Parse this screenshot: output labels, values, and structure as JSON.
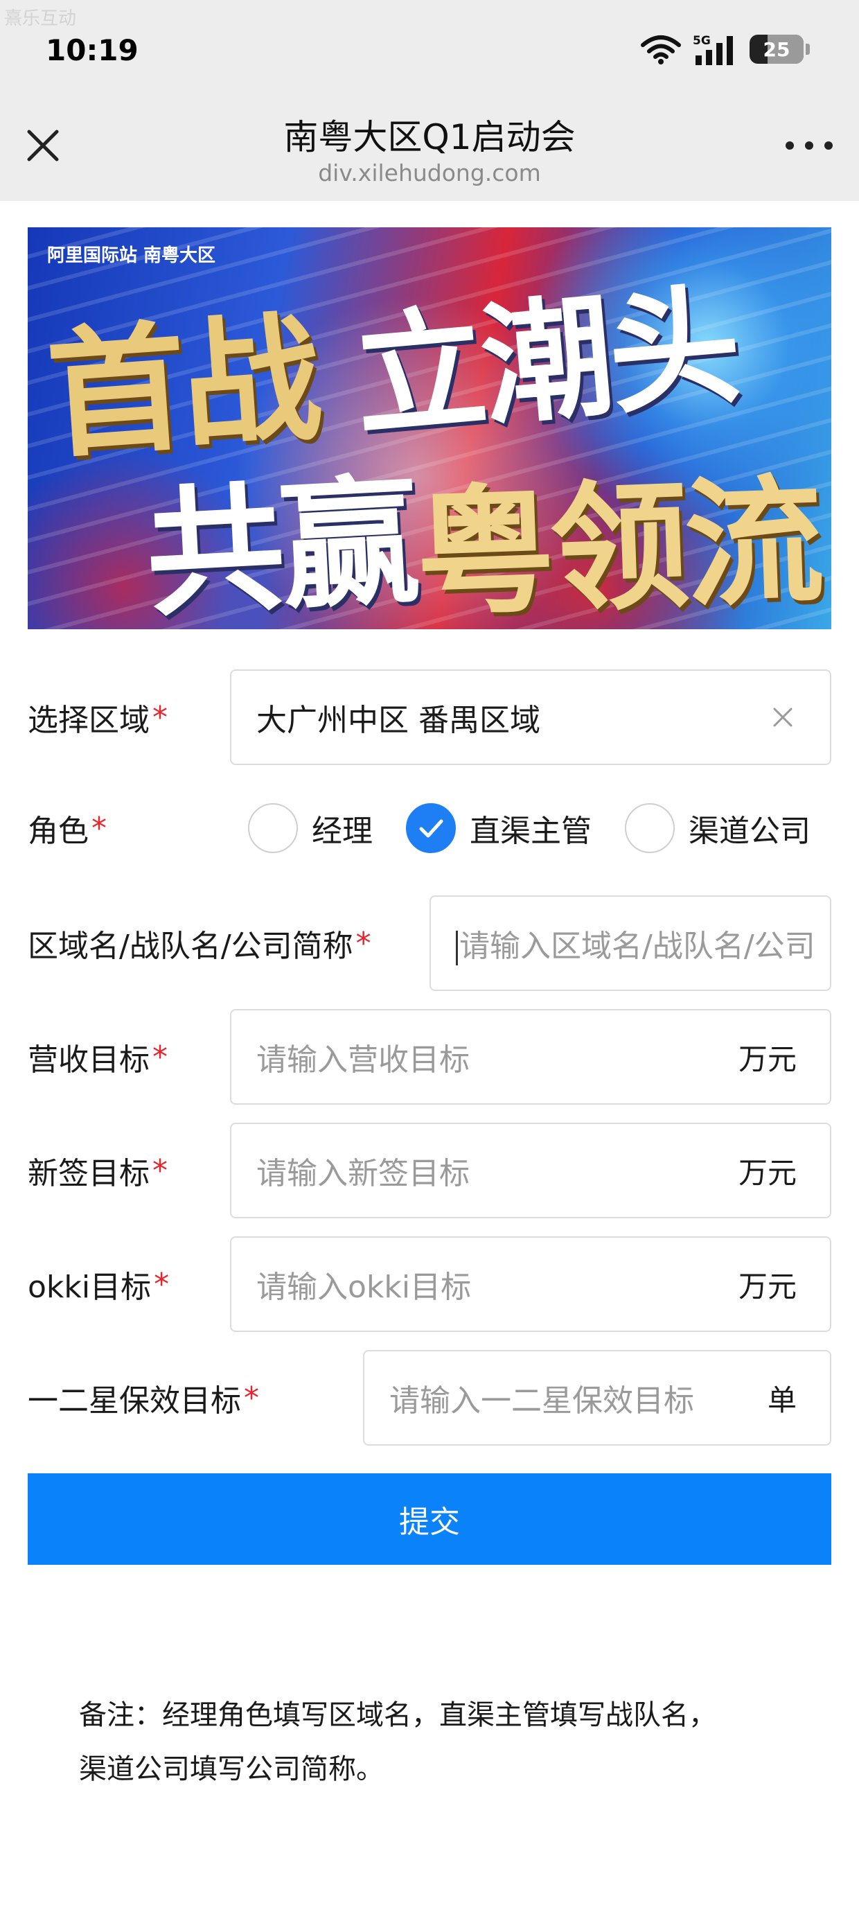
{
  "watermark": "熹乐互动",
  "status_bar": {
    "time": "10:19",
    "network": "5G",
    "battery": "25"
  },
  "titlebar": {
    "title": "南粤大区Q1启动会",
    "domain": "div.xilehudong.com"
  },
  "banner": {
    "logo_text": "阿里国际站 南粤大区",
    "slogan_line1a": "首战",
    "slogan_line1b": "立潮头",
    "slogan_line2a": "共赢",
    "slogan_line2b": "粤领流"
  },
  "form": {
    "region": {
      "label": "选择区域",
      "required": "*",
      "value": "大广州中区 番禺区域"
    },
    "role": {
      "label": "角色",
      "required": "*",
      "options": [
        "经理",
        "直渠主管",
        "渠道公司"
      ],
      "selected": "直渠主管"
    },
    "name": {
      "label": "区域名/战队名/公司简称",
      "required": "*",
      "placeholder": "请输入区域名/战队名/公司"
    },
    "revenue": {
      "label": "营收目标",
      "required": "*",
      "placeholder": "请输入营收目标",
      "unit": "万元"
    },
    "new_sign": {
      "label": "新签目标",
      "required": "*",
      "placeholder": "请输入新签目标",
      "unit": "万元"
    },
    "okki": {
      "label": "okki目标",
      "required": "*",
      "placeholder": "请输入okki目标",
      "unit": "万元"
    },
    "star": {
      "label": "一二星保效目标",
      "required": "*",
      "placeholder": "请输入一二星保效目标",
      "unit": "单"
    },
    "submit_label": "提交"
  },
  "note": {
    "line1": "备注：经理角色填写区域名，直渠主管填写战队名，",
    "line2": "渠道公司填写公司简称。"
  },
  "colors": {
    "primary": "#0a82fa",
    "required": "#e8232b",
    "titlebar_bg": "#ededed"
  },
  "icons": [
    "close-icon",
    "more-icon",
    "wifi-icon",
    "signal-icon",
    "battery-icon",
    "clear-icon",
    "check-icon"
  ]
}
